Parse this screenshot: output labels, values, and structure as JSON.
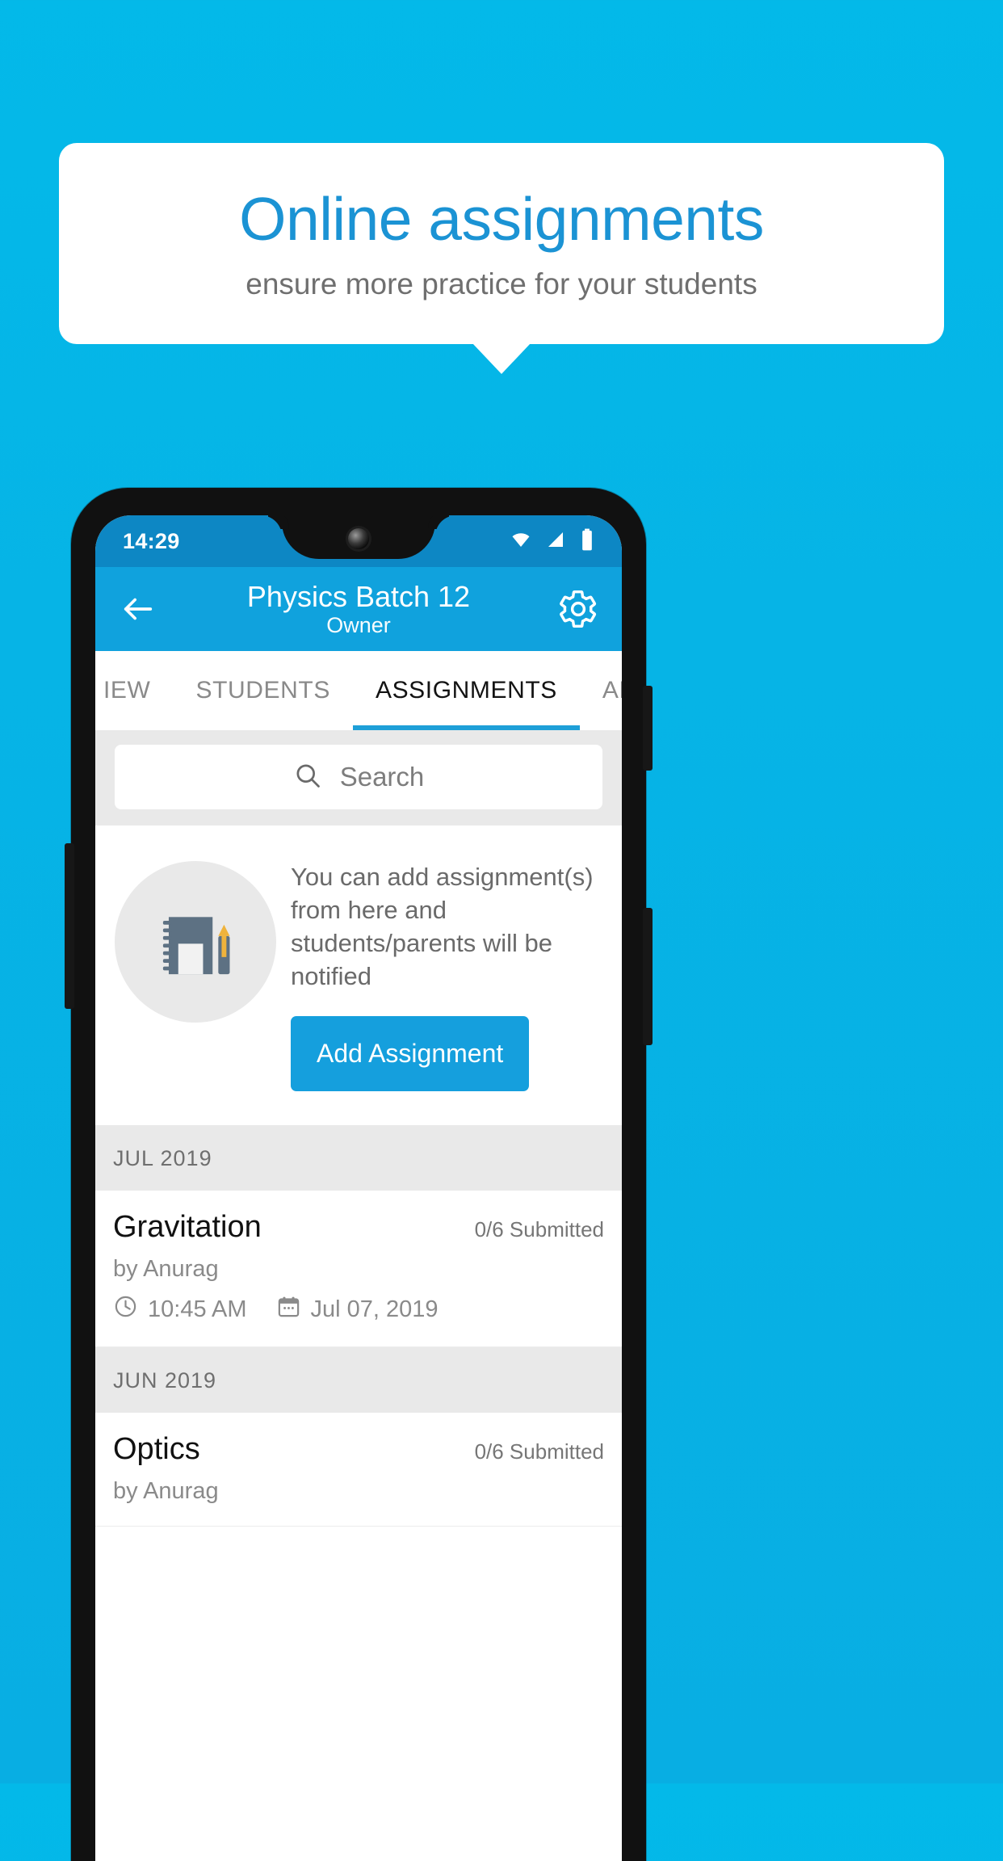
{
  "promo": {
    "title": "Online assignments",
    "subtitle": "ensure more practice for your students"
  },
  "colors": {
    "background": "#06b4e6",
    "accent": "#159fdd",
    "appbar": "#10a2dd",
    "statusbar": "#0d87c4",
    "title_blue": "#1b93d4"
  },
  "phone": {
    "statusbar": {
      "time": "14:29",
      "icons": [
        "wifi-icon",
        "signal-icon",
        "battery-icon"
      ]
    },
    "appbar": {
      "back_icon": "back-arrow-icon",
      "title": "Physics Batch 12",
      "subtitle": "Owner",
      "settings_icon": "gear-icon"
    },
    "tabs": [
      {
        "label": "IEW",
        "active": false
      },
      {
        "label": "STUDENTS",
        "active": false
      },
      {
        "label": "ASSIGNMENTS",
        "active": true
      },
      {
        "label": "ANNOUNCEMEN",
        "active": false
      }
    ],
    "search": {
      "placeholder": "Search",
      "icon": "search-icon"
    },
    "empty_state": {
      "illustration": "notebook-pen-icon",
      "message": "You can add assignment(s) from here and students/parents will be notified",
      "button_label": "Add Assignment"
    },
    "groups": [
      {
        "month": "JUL 2019",
        "items": [
          {
            "title": "Gravitation",
            "submitted": "0/6 Submitted",
            "author": "by Anurag",
            "time": "10:45 AM",
            "date": "Jul 07, 2019",
            "time_icon": "clock-icon",
            "date_icon": "calendar-icon"
          }
        ]
      },
      {
        "month": "JUN 2019",
        "items": [
          {
            "title": "Optics",
            "submitted": "0/6 Submitted",
            "author": "by Anurag",
            "time": "",
            "date": "",
            "time_icon": "clock-icon",
            "date_icon": "calendar-icon"
          }
        ]
      }
    ]
  }
}
